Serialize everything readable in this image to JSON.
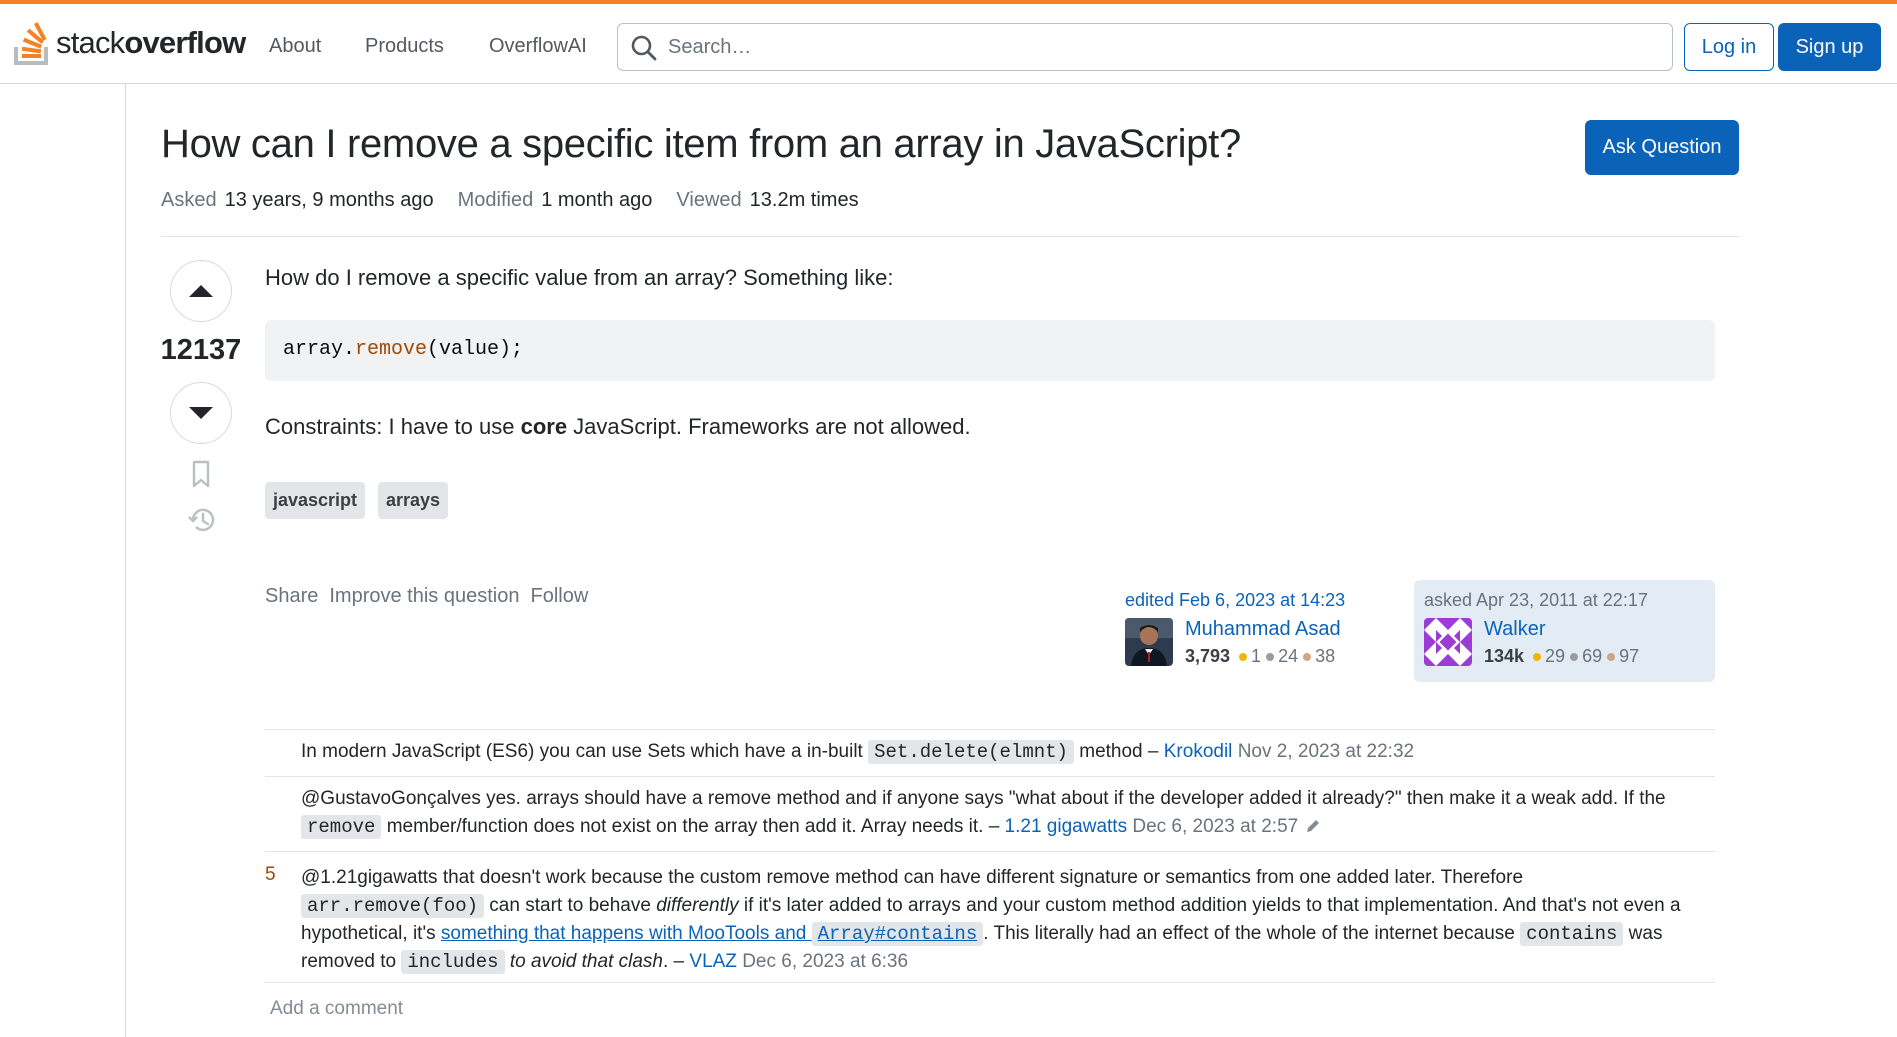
{
  "header": {
    "brand_part1": "stack",
    "brand_part2": "overflow",
    "nav": [
      "About",
      "Products",
      "OverflowAI"
    ],
    "search_placeholder": "Search…",
    "login_label": "Log in",
    "signup_label": "Sign up",
    "accent_color": "#f48225"
  },
  "question": {
    "title": "How can I remove a specific item from an array in JavaScript?",
    "ask_button": "Ask Question",
    "meta": {
      "asked_label": "Asked",
      "asked_value": "13 years, 9 months ago",
      "modified_label": "Modified",
      "modified_value": "1 month ago",
      "viewed_label": "Viewed",
      "viewed_value": "13.2m times"
    },
    "votes": "12137",
    "body_intro": "How do I remove a specific value from an array? Something like:",
    "code": {
      "obj": "array.",
      "fn": "remove",
      "args": "(value);"
    },
    "constraints_pre": "Constraints: I have to use ",
    "constraints_bold": "core",
    "constraints_post": " JavaScript. Frameworks are not allowed.",
    "tags": [
      "javascript",
      "arrays"
    ],
    "actions": [
      "Share",
      "Improve this question",
      "Follow"
    ],
    "editor": {
      "action": "edited Feb 6, 2023 at 14:23",
      "name": "Muhammad Asad",
      "reputation": "3,793",
      "gold": "1",
      "silver": "24",
      "bronze": "38"
    },
    "owner": {
      "action": "asked Apr 23, 2011 at 22:17",
      "name": "Walker",
      "reputation": "134k",
      "gold": "29",
      "silver": "69",
      "bronze": "97"
    }
  },
  "comments": [
    {
      "text1": "In modern JavaScript (ES6) you can use Sets which have a in-built ",
      "code1": "Set.delete(elmnt)",
      "text2": " method – ",
      "user": "Krokodil",
      "date": "Nov 2, 2023 at 22:32"
    },
    {
      "text1": "@GustavoGonçalves yes. arrays should have a remove method and if anyone says \"what about if the developer added it already?\" then make it a weak add. If the ",
      "code1": "remove",
      "text2": " member/function does not exist on the array then add it. Array needs it. – ",
      "user": "1.21 gigawatts",
      "date": "Dec 6, 2023 at 2:57"
    },
    {
      "score": "5",
      "text1": "@1.21gigawatts that doesn't work because the custom remove method can have different signature or semantics from one added later. Therefore ",
      "code1": "arr.remove(foo)",
      "text2": " can start to behave ",
      "em1": "differently",
      "text3": " if it's later added to arrays and your custom method addition yields to that implementation. And that's not even a hypothetical, it's ",
      "link_text": "something that happens with MooTools and ",
      "link_code": "Array#contains",
      "text4": ". This literally had an effect of the whole of the internet because ",
      "code2": "contains",
      "text5": " was removed to ",
      "code3": "includes",
      "em2": "to avoid that clash",
      "text6": ". – ",
      "user": "VLAZ",
      "date": "Dec 6, 2023 at 6:36"
    }
  ],
  "add_comment": "Add a comment"
}
